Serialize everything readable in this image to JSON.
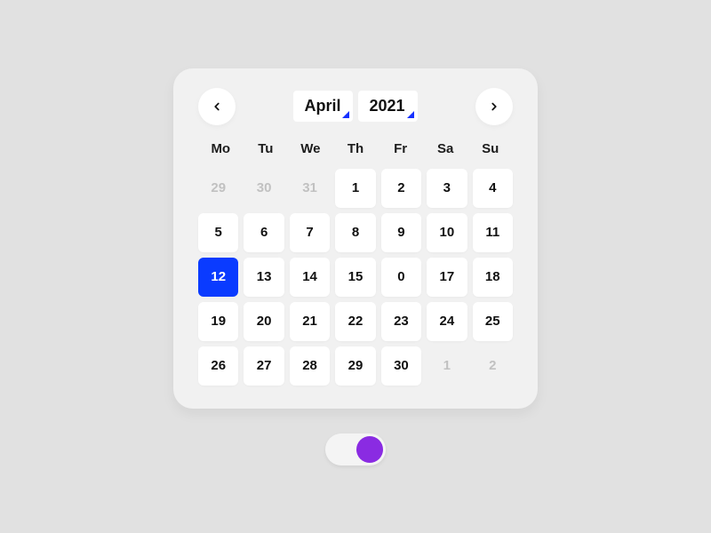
{
  "calendar": {
    "month": "April",
    "year": "2021",
    "dow": [
      "Mo",
      "Tu",
      "We",
      "Th",
      "Fr",
      "Sa",
      "Su"
    ],
    "days": [
      {
        "n": "29",
        "in": false,
        "sel": false
      },
      {
        "n": "30",
        "in": false,
        "sel": false
      },
      {
        "n": "31",
        "in": false,
        "sel": false
      },
      {
        "n": "1",
        "in": true,
        "sel": false
      },
      {
        "n": "2",
        "in": true,
        "sel": false
      },
      {
        "n": "3",
        "in": true,
        "sel": false
      },
      {
        "n": "4",
        "in": true,
        "sel": false
      },
      {
        "n": "5",
        "in": true,
        "sel": false
      },
      {
        "n": "6",
        "in": true,
        "sel": false
      },
      {
        "n": "7",
        "in": true,
        "sel": false
      },
      {
        "n": "8",
        "in": true,
        "sel": false
      },
      {
        "n": "9",
        "in": true,
        "sel": false
      },
      {
        "n": "10",
        "in": true,
        "sel": false
      },
      {
        "n": "11",
        "in": true,
        "sel": false
      },
      {
        "n": "12",
        "in": true,
        "sel": true
      },
      {
        "n": "13",
        "in": true,
        "sel": false
      },
      {
        "n": "14",
        "in": true,
        "sel": false
      },
      {
        "n": "15",
        "in": true,
        "sel": false
      },
      {
        "n": "0",
        "in": true,
        "sel": false
      },
      {
        "n": "17",
        "in": true,
        "sel": false
      },
      {
        "n": "18",
        "in": true,
        "sel": false
      },
      {
        "n": "19",
        "in": true,
        "sel": false
      },
      {
        "n": "20",
        "in": true,
        "sel": false
      },
      {
        "n": "21",
        "in": true,
        "sel": false
      },
      {
        "n": "22",
        "in": true,
        "sel": false
      },
      {
        "n": "23",
        "in": true,
        "sel": false
      },
      {
        "n": "24",
        "in": true,
        "sel": false
      },
      {
        "n": "25",
        "in": true,
        "sel": false
      },
      {
        "n": "26",
        "in": true,
        "sel": false
      },
      {
        "n": "27",
        "in": true,
        "sel": false
      },
      {
        "n": "28",
        "in": true,
        "sel": false
      },
      {
        "n": "29",
        "in": true,
        "sel": false
      },
      {
        "n": "30",
        "in": true,
        "sel": false
      },
      {
        "n": "1",
        "in": false,
        "sel": false
      },
      {
        "n": "2",
        "in": false,
        "sel": false
      }
    ]
  },
  "toggle": {
    "on": true
  }
}
